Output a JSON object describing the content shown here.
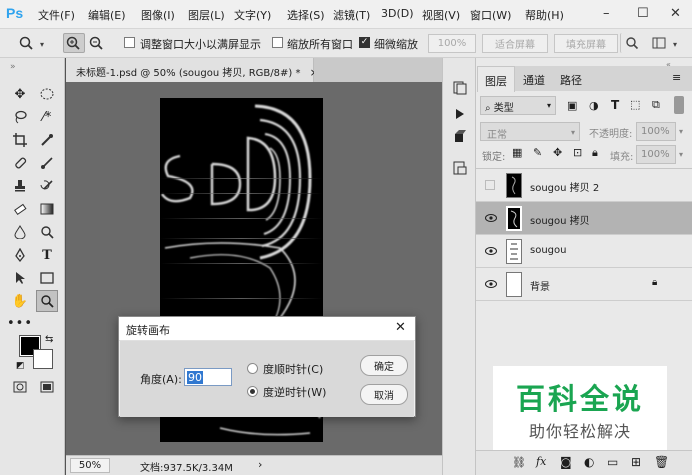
{
  "app": {
    "logo": "Ps"
  },
  "menu": [
    "文件(F)",
    "编辑(E)",
    "图像(I)",
    "图层(L)",
    "文字(Y)",
    "选择(S)",
    "滤镜(T)",
    "3D(D)",
    "视图(V)",
    "窗口(W)",
    "帮助(H)"
  ],
  "window_controls": {
    "minimize": "–",
    "maximize": "☐",
    "close": "✕"
  },
  "options": {
    "resize_windows": "调整窗口大小以满屏显示",
    "zoom_all": "缩放所有窗口",
    "scrubby_zoom": "细微缩放",
    "scrubby_checked": true,
    "pct": "100%",
    "fit_screen": "适合屏幕",
    "fill_screen": "填充屏幕"
  },
  "document": {
    "tab_title": "未标题-1.psd @ 50% (sougou 拷贝, RGB/8#) *",
    "tab_close": "×",
    "zoom": "50%",
    "doc_info": "文档:937.5K/3.34M"
  },
  "panel": {
    "tabs": [
      "图层",
      "通道",
      "路径"
    ],
    "filter_kind": "类型",
    "blend_mode": "正常",
    "opacity_label": "不透明度:",
    "opacity": "100%",
    "lock_label": "锁定:",
    "fill_label": "填充:",
    "fill": "100%",
    "layers": [
      {
        "name": "sougou 拷贝 2",
        "visible": false,
        "selected": false
      },
      {
        "name": "sougou 拷贝",
        "visible": true,
        "selected": true
      },
      {
        "name": "sougou",
        "visible": true,
        "selected": false
      },
      {
        "name": "背景",
        "visible": true,
        "selected": false,
        "locked": true
      }
    ],
    "bottom_icons": [
      "link-icon",
      "fx-icon",
      "mask-icon",
      "adjustment-icon",
      "group-icon",
      "new-layer-icon",
      "trash-icon"
    ]
  },
  "dialog": {
    "title": "旋转画布",
    "close": "✕",
    "angle_label": "角度(A):",
    "angle_value": "90",
    "cw_label": "度顺时针(C)",
    "ccw_label": "度逆时针(W)",
    "ccw_selected": true,
    "ok": "确定",
    "cancel": "取消"
  },
  "watermark": {
    "title": "百科全说",
    "subtitle": "助你轻松解决",
    "title_color": "#1aa551"
  }
}
